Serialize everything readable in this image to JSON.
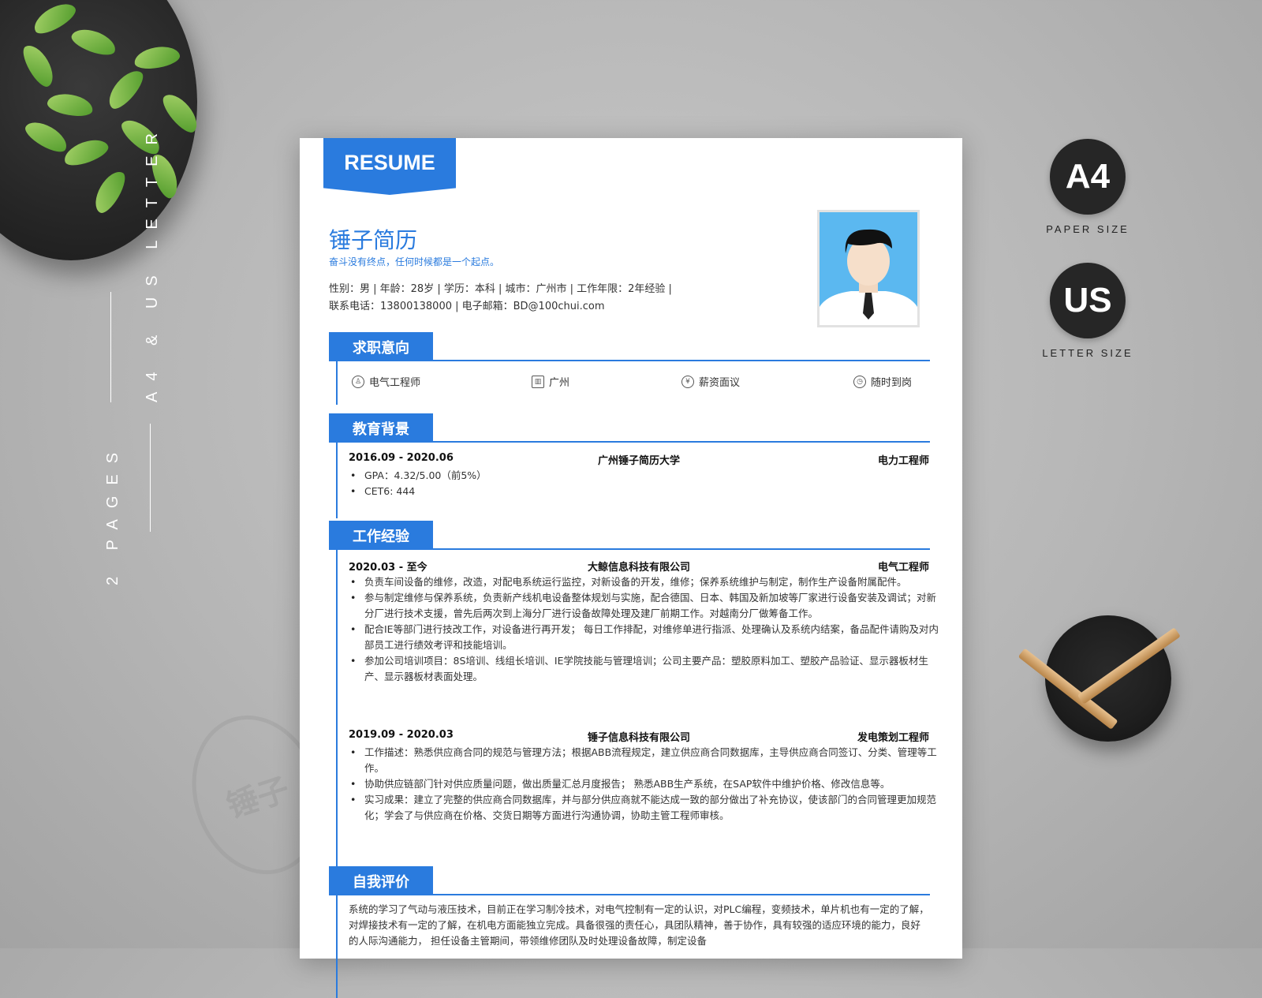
{
  "side": {
    "letters": "A4 & US LETTER",
    "pages": "2 PAGES"
  },
  "badges": [
    {
      "label": "A4",
      "caption": "PAPER SIZE"
    },
    {
      "label": "US",
      "caption": "LETTER SIZE"
    }
  ],
  "stamp": "锤子",
  "resume": {
    "tag": "RESUME",
    "name": "锤子简历",
    "motto": "奋斗没有终点，任何时候都是一个起点。",
    "info_line1": "性别：男 | 年龄：28岁 | 学历：本科 | 城市：广州市 | 工作年限：2年经验 |",
    "info_line2": "联系电话：13800138000 | 电子邮箱：BD@100chui.com",
    "sections": {
      "intent": "求职意向",
      "education": "教育背景",
      "work": "工作经验",
      "self": "自我评价"
    },
    "intent": [
      {
        "icon": "tie-icon",
        "text": "电气工程师"
      },
      {
        "icon": "building-icon",
        "text": "广州"
      },
      {
        "icon": "yuan-icon",
        "text": "薪资面议"
      },
      {
        "icon": "clock-icon",
        "text": "随时到岗"
      }
    ],
    "education": {
      "date": "2016.09 - 2020.06",
      "school": "广州锤子简历大学",
      "major": "电力工程师",
      "items": [
        "GPA：4.32/5.00（前5%）",
        "CET6: 444"
      ]
    },
    "jobs": [
      {
        "date": "2020.03 - 至今",
        "company": "大鲸信息科技有限公司",
        "title": "电气工程师",
        "items": [
          "负责车间设备的维修，改造，对配电系统运行监控，对新设备的开发，维修；保养系统维护与制定，制作生产设备附属配件。",
          "参与制定维修与保养系统，负责新产线机电设备整体规划与实施，配合德国、日本、韩国及新加坡等厂家进行设备安装及调试；对新分厂进行技术支援，曾先后两次到上海分厂进行设备故障处理及建厂前期工作。对越南分厂做筹备工作。",
          "配合IE等部门进行技改工作，对设备进行再开发； 每日工作排配，对维修单进行指派、处理确认及系统内结案，备品配件请购及对内部员工进行绩效考评和技能培训。",
          "参加公司培训项目：8S培训、线组长培训、IE学院技能与管理培训；公司主要产品：塑胶原料加工、塑胶产品验证、显示器板材生产、显示器板材表面处理。"
        ]
      },
      {
        "date": "2019.09 - 2020.03",
        "company": "锤子信息科技有限公司",
        "title": "发电策划工程师",
        "items": [
          "工作描述：熟悉供应商合同的规范与管理方法；根据ABB流程规定，建立供应商合同数据库，主导供应商合同签订、分类、管理等工作。",
          "协助供应链部门针对供应质量问题，做出质量汇总月度报告； 熟悉ABB生产系统，在SAP软件中维护价格、修改信息等。",
          "实习成果：建立了完整的供应商合同数据库，并与部分供应商就不能达成一致的部分做出了补充协议，使该部门的合同管理更加规范化；学会了与供应商在价格、交货日期等方面进行沟通协调，协助主管工程师审核。"
        ]
      }
    ],
    "self_text": "系统的学习了气动与液压技术，目前正在学习制冷技术，对电气控制有一定的认识，对PLC编程，变频技术，单片机也有一定的了解，对焊接技术有一定的了解，在机电方面能独立完成。具备很强的责任心，具团队精神，善于协作，具有较强的适应环境的能力，良好的人际沟通能力， 担任设备主管期间，带领维修团队及时处理设备故障，制定设备"
  },
  "colors": {
    "accent": "#2a7bde",
    "badge": "#262626"
  }
}
